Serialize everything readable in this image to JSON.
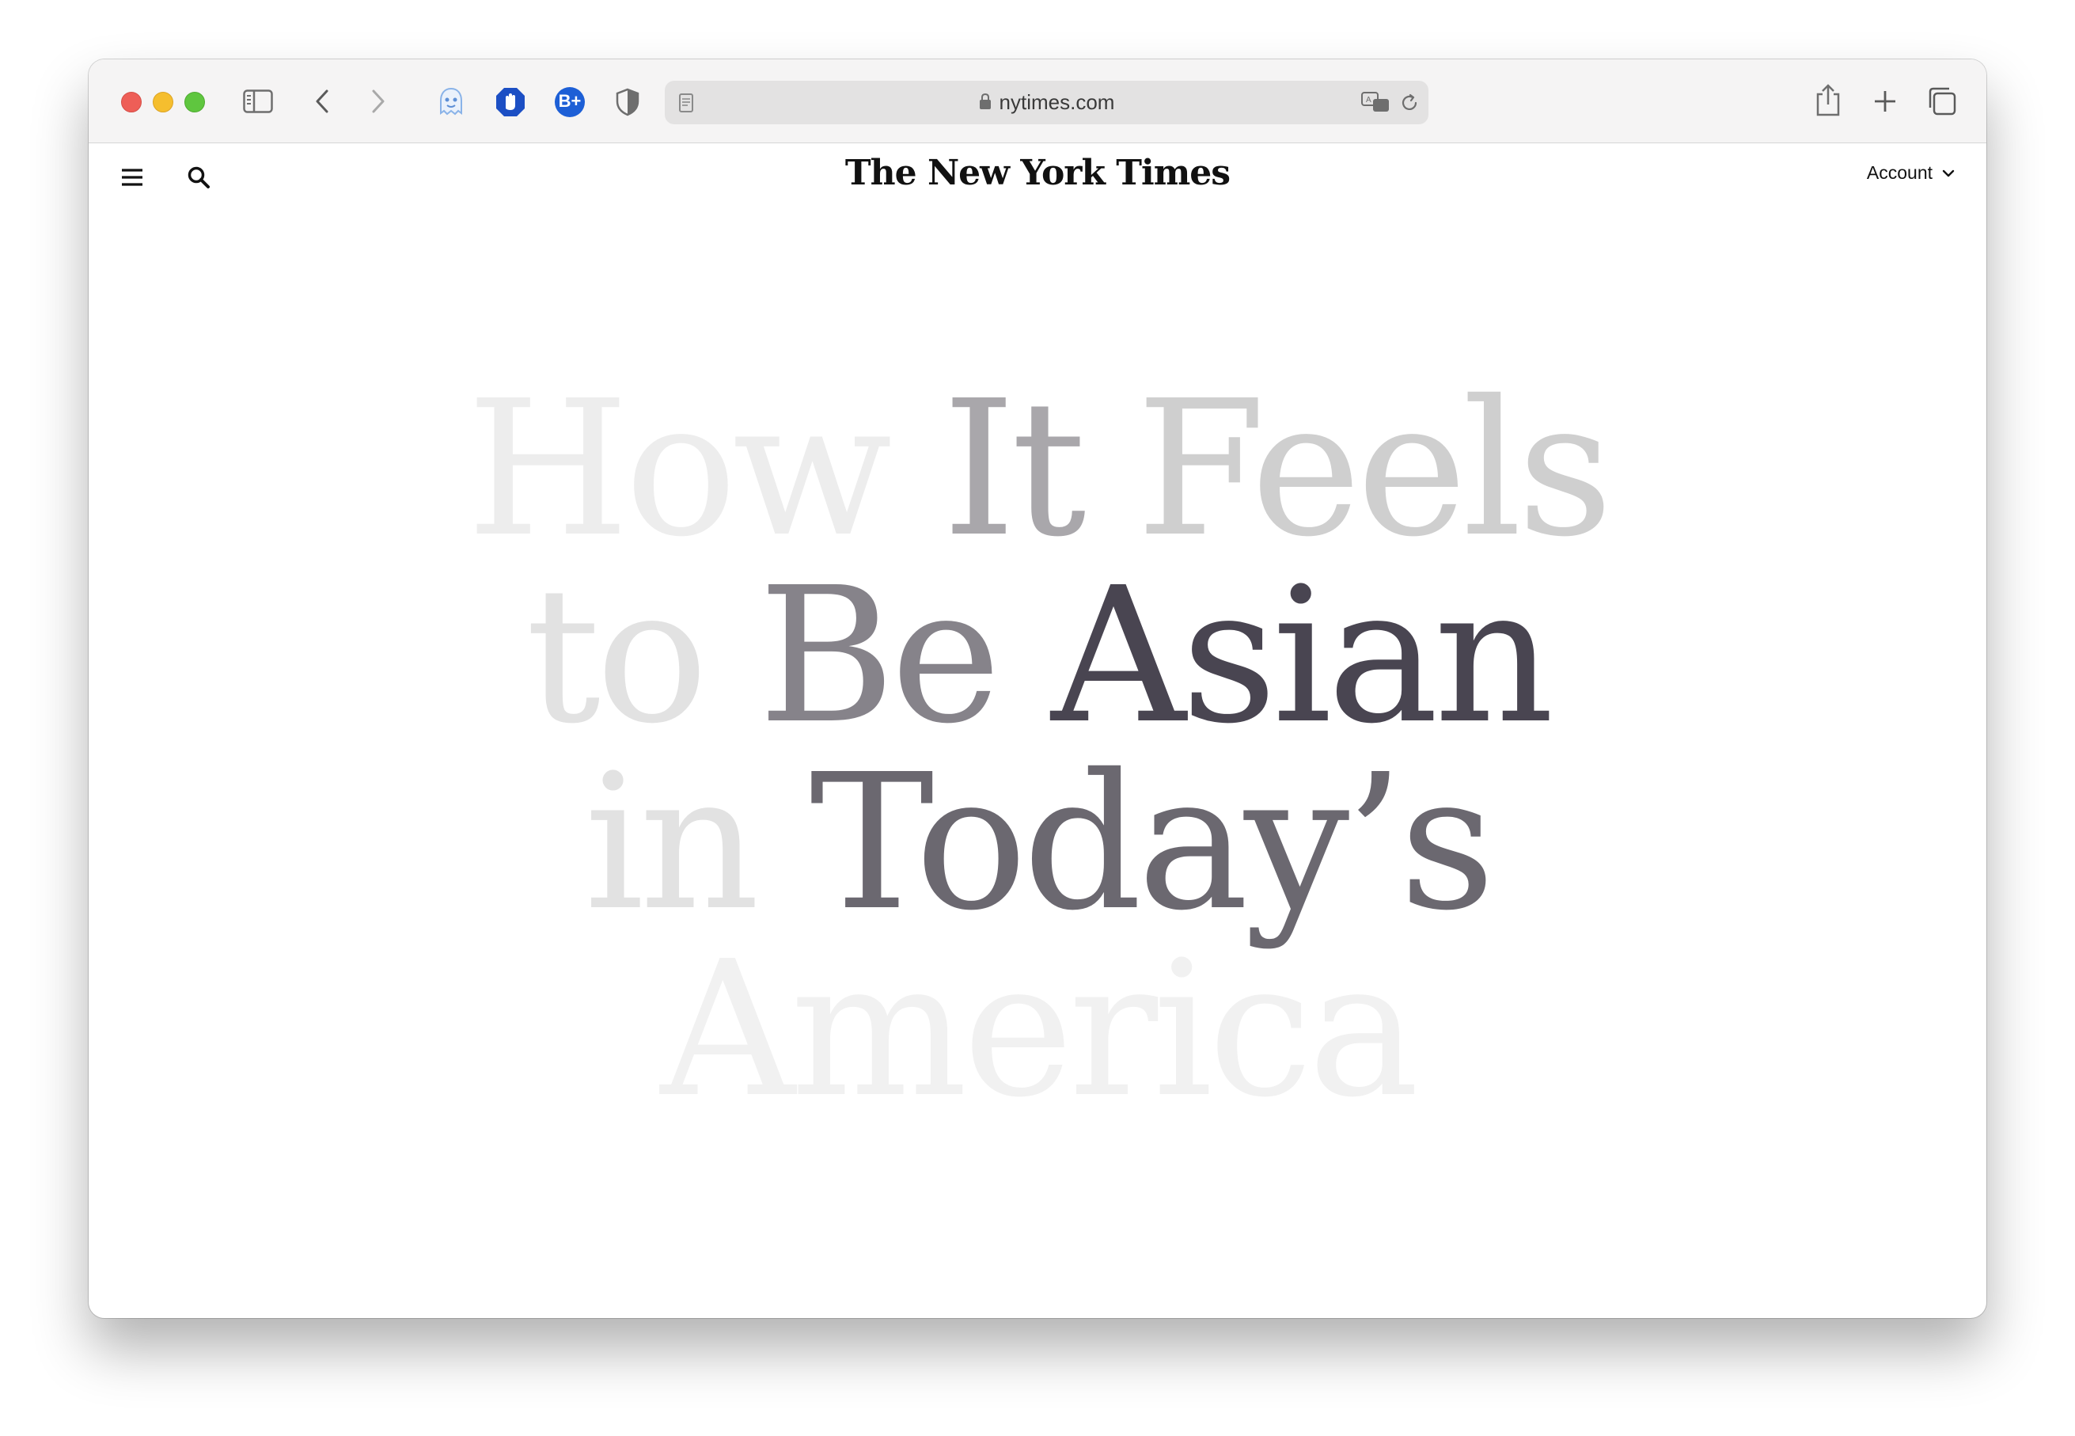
{
  "browser": {
    "address": "nytimes.com",
    "extensions": [
      "ghostery-icon",
      "adblock-hand-icon",
      "bplus-icon",
      "shield-icon"
    ],
    "extension_bplus_label": "B+"
  },
  "site": {
    "masthead": "The New York Times",
    "account_label": "Account"
  },
  "headline": {
    "line1": [
      "How",
      "It",
      "Feels"
    ],
    "line2": [
      "to",
      "Be",
      "Asian"
    ],
    "line3": [
      "in",
      "Today’s"
    ],
    "line4": [
      "America"
    ]
  },
  "colors": {
    "traffic_close": "#ee5e57",
    "traffic_min": "#f5be2e",
    "traffic_max": "#5fc63f",
    "extension_blue": "#1d5fd6",
    "headline_dark": "#494551",
    "headline_light": "#ededed"
  }
}
